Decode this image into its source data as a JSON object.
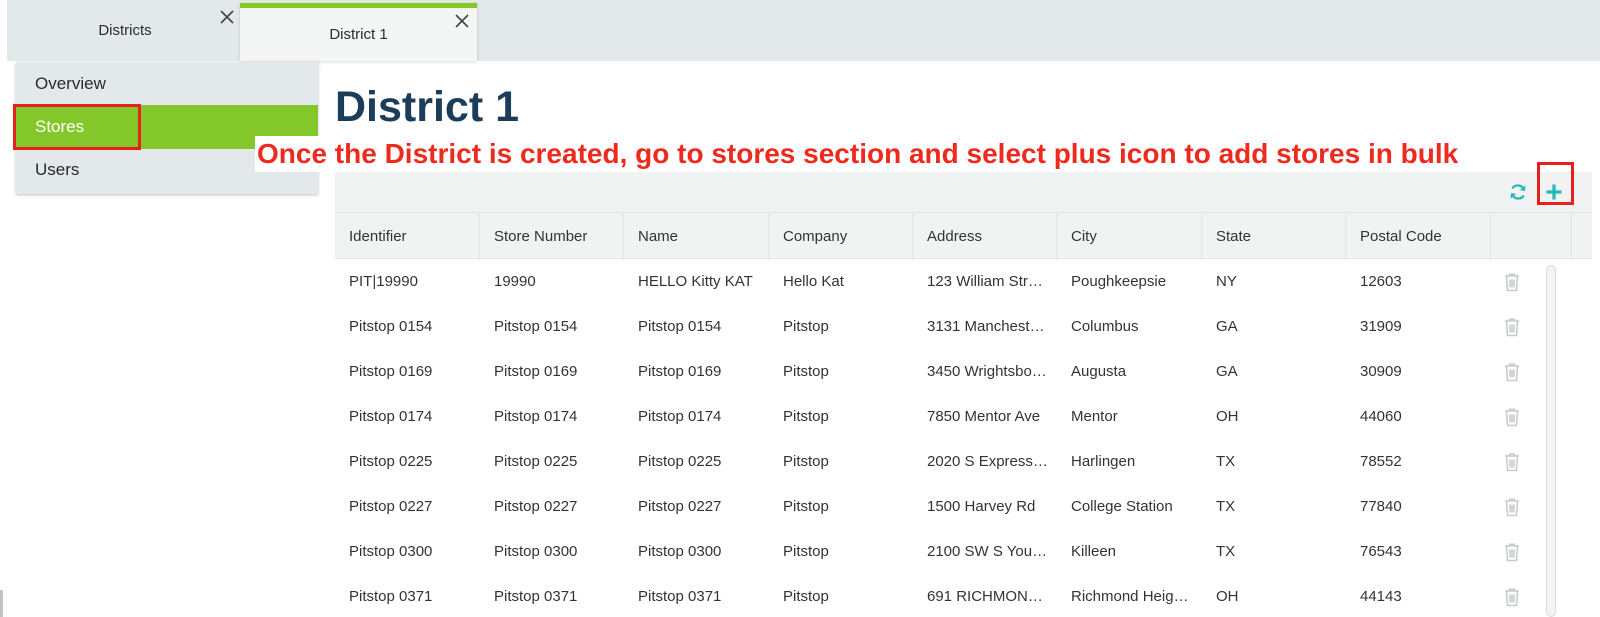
{
  "tabs": [
    {
      "label": "Districts"
    },
    {
      "label": "District 1"
    }
  ],
  "sidebar": {
    "items": [
      {
        "label": "Overview"
      },
      {
        "label": "Stores"
      },
      {
        "label": "Users"
      }
    ]
  },
  "page": {
    "title": "District 1",
    "annotation": "Once the District is created, go to stores section and select plus icon to add stores in bulk"
  },
  "toolbar": {
    "refresh_icon": "refresh-icon",
    "add_icon": "plus-icon"
  },
  "table": {
    "columns": [
      "Identifier",
      "Store Number",
      "Name",
      "Company",
      "Address",
      "City",
      "State",
      "Postal Code"
    ],
    "rows": [
      [
        "PIT|19990",
        "19990",
        "HELLO Kitty KAT",
        "Hello Kat",
        "123 William Str…",
        "Poughkeepsie",
        "NY",
        "12603"
      ],
      [
        "Pitstop 0154",
        "Pitstop 0154",
        "Pitstop 0154",
        "Pitstop",
        "3131 Manchest…",
        "Columbus",
        "GA",
        "31909"
      ],
      [
        "Pitstop 0169",
        "Pitstop 0169",
        "Pitstop 0169",
        "Pitstop",
        "3450 Wrightsbo…",
        "Augusta",
        "GA",
        "30909"
      ],
      [
        "Pitstop 0174",
        "Pitstop 0174",
        "Pitstop 0174",
        "Pitstop",
        "7850 Mentor Ave",
        "Mentor",
        "OH",
        "44060"
      ],
      [
        "Pitstop 0225",
        "Pitstop 0225",
        "Pitstop 0225",
        "Pitstop",
        "2020 S Express…",
        "Harlingen",
        "TX",
        "78552"
      ],
      [
        "Pitstop 0227",
        "Pitstop 0227",
        "Pitstop 0227",
        "Pitstop",
        "1500 Harvey Rd",
        "College Station",
        "TX",
        "77840"
      ],
      [
        "Pitstop 0300",
        "Pitstop 0300",
        "Pitstop 0300",
        "Pitstop",
        "2100 SW S You…",
        "Killeen",
        "TX",
        "76543"
      ],
      [
        "Pitstop 0371",
        "Pitstop 0371",
        "Pitstop 0371",
        "Pitstop",
        "691 RICHMON…",
        "Richmond Heig…",
        "OH",
        "44143"
      ]
    ]
  },
  "colors": {
    "accent_green": "#84c72a",
    "title_navy": "#1c3d5a",
    "annotation_red": "#ee2a1e",
    "icon_teal": "#27b6b8"
  }
}
